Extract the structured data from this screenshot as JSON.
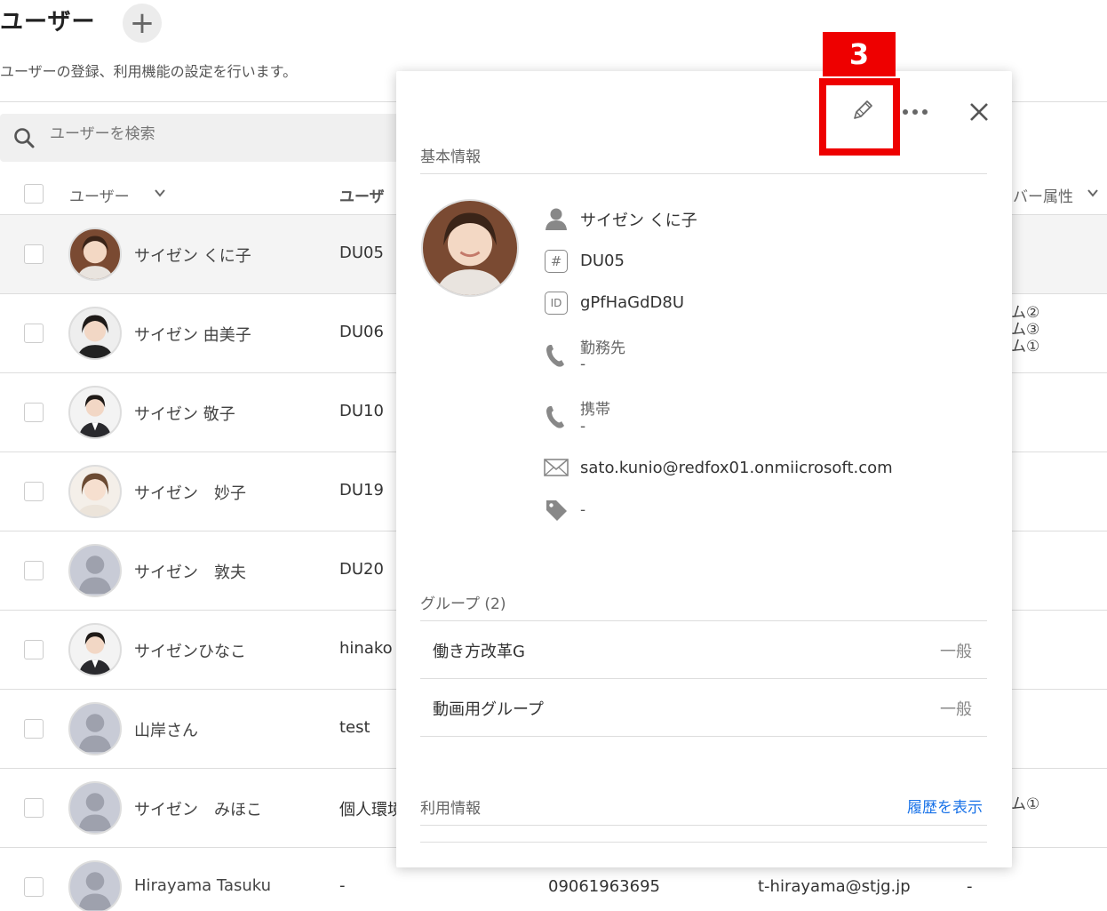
{
  "header": {
    "title": "ユーザー",
    "add_icon": "plus-icon",
    "description": "ユーザーの登録、利用機能の設定を行います。"
  },
  "search": {
    "placeholder": "ユーザーを検索"
  },
  "table": {
    "columns": {
      "user": "ユーザー",
      "userid": "ユーザ",
      "attribute": "バー属性"
    },
    "rows": [
      {
        "name": "サイゼン くに子",
        "id": "DU05",
        "avatar": "photo"
      },
      {
        "name": "サイゼン 由美子",
        "id": "DU06",
        "avatar": "photo",
        "extra": [
          "ム②",
          "ム③",
          "ム①"
        ]
      },
      {
        "name": "サイゼン 敬子",
        "id": "DU10",
        "avatar": "photo"
      },
      {
        "name": "サイゼン　妙子",
        "id": "DU19",
        "avatar": "photo"
      },
      {
        "name": "サイゼン　敦夫",
        "id": "DU20",
        "avatar": "placeholder"
      },
      {
        "name": "サイゼンひなこ",
        "id": "hinako",
        "avatar": "photo"
      },
      {
        "name": "山岸さん",
        "id": "test",
        "avatar": "placeholder"
      },
      {
        "name": "サイゼン　みほこ",
        "id": "個人環境",
        "avatar": "placeholder",
        "extra": [
          "ム①"
        ]
      },
      {
        "name": "Hirayama Tasuku",
        "id": "-",
        "avatar": "placeholder",
        "phone": "09061963695",
        "email": "t-hirayama@stjg.jp",
        "attr": "-"
      }
    ]
  },
  "panel": {
    "basic_info_title": "基本情報",
    "name": "サイゼン くに子",
    "employee_no": "DU05",
    "user_id": "gPfHaGdD8U",
    "work_phone_label": "勤務先",
    "work_phone_value": "-",
    "mobile_label": "携帯",
    "mobile_value": "-",
    "email": "sato.kunio@redfox01.onmiicrosoft.com",
    "tag_value": "-",
    "id_badge": "ID",
    "hash_badge": "#",
    "groups_title": "グループ (2)",
    "groups": [
      {
        "name": "働き方改革G",
        "role": "一般"
      },
      {
        "name": "動画用グループ",
        "role": "一般"
      }
    ],
    "usage_title": "利用情報",
    "history_link": "履歴を表示",
    "icons": [
      "pencil-icon",
      "more-icon",
      "close-icon",
      "person-icon",
      "hash-icon",
      "id-icon",
      "phone-icon",
      "mail-icon",
      "tag-icon"
    ]
  },
  "annotation": {
    "step_number": "3",
    "color": "#ee0000"
  }
}
